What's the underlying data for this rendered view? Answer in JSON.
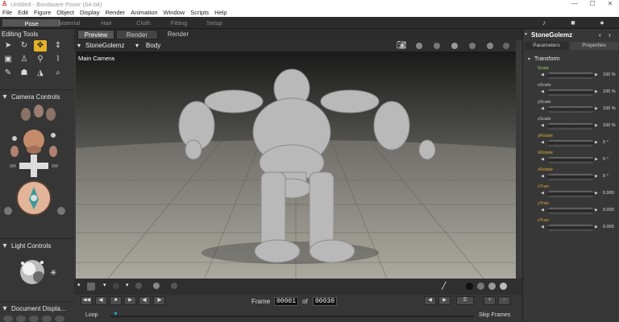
{
  "titlebar": {
    "title": "Untitled - Bondware Poser (64-bit)",
    "min": "—",
    "max": "☐",
    "close": "✕"
  },
  "menu": [
    "File",
    "Edit",
    "Figure",
    "Object",
    "Display",
    "Render",
    "Animation",
    "Window",
    "Scripts",
    "Help"
  ],
  "rooms": [
    "Pose",
    "Material",
    "Hair",
    "Cloth",
    "Fitting",
    "Setup"
  ],
  "left": {
    "editing_tools": "Editing Tools",
    "camera_controls": "Camera Controls",
    "light_controls": "Light Controls",
    "document_display": "Document Displa..."
  },
  "viewport": {
    "tabs": [
      "Preview",
      "Render"
    ],
    "render_label": "Render",
    "figure": "StoneGolemz",
    "actor": "Body",
    "camera": "Main Camera"
  },
  "playback": {
    "frame_label": "Frame",
    "current": "00001",
    "of": "of",
    "total": "00030",
    "loop": "Loop",
    "skip": "Skip Frames"
  },
  "right": {
    "figure": "StoneGolemz",
    "tabs": [
      "Parameters",
      "Properties"
    ],
    "group": "Transform",
    "params": [
      {
        "label": "Scale",
        "value": "100 %",
        "color": "green"
      },
      {
        "label": "xScale",
        "value": "100 %",
        "color": "normal"
      },
      {
        "label": "yScale",
        "value": "100 %",
        "color": "normal"
      },
      {
        "label": "zScale",
        "value": "100 %",
        "color": "normal"
      },
      {
        "label": "yRotate",
        "value": "0 °",
        "color": "gold"
      },
      {
        "label": "xRotate",
        "value": "0 °",
        "color": "gold"
      },
      {
        "label": "zRotate",
        "value": "0 °",
        "color": "gold"
      },
      {
        "label": "xTran",
        "value": "0.000",
        "color": "gold"
      },
      {
        "label": "yTran",
        "value": "0.000",
        "color": "gold"
      },
      {
        "label": "zTran",
        "value": "0.000",
        "color": "gold"
      }
    ]
  },
  "colors": {
    "accent": "#e7b326",
    "panel": "#363636",
    "viewport_floor": "#9a9a90"
  }
}
